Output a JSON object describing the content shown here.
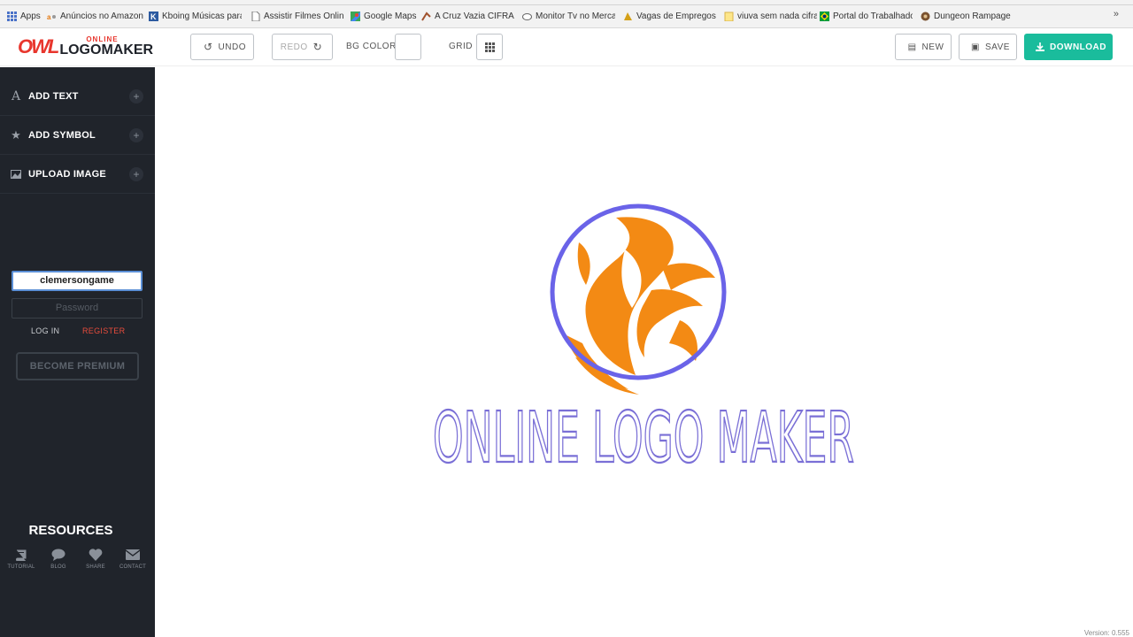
{
  "bookmarks": [
    {
      "label": "Apps",
      "icon": "apps-grid-icon"
    },
    {
      "label": "Anúncios no Amazon",
      "icon": "amazon-icon"
    },
    {
      "label": "Kboing Músicas para",
      "icon": "kboing-icon"
    },
    {
      "label": "Assistir Filmes Online",
      "icon": "page-icon"
    },
    {
      "label": "Google Maps",
      "icon": "maps-icon"
    },
    {
      "label": "A Cruz Vazia CIFRA S",
      "icon": "cifra-icon"
    },
    {
      "label": "Monitor Tv no Merca",
      "icon": "monitor-icon"
    },
    {
      "label": "Vagas de Empregos e",
      "icon": "vagas-icon"
    },
    {
      "label": "viuva sem nada cifra",
      "icon": "folder-icon"
    },
    {
      "label": "Portal do Trabalhador",
      "icon": "portal-icon"
    },
    {
      "label": "Dungeon Rampage n",
      "icon": "dungeon-icon"
    }
  ],
  "bookmarks_more": "»",
  "logo": {
    "mark": "OWL",
    "small": "ONLINE",
    "big": "LOGOMAKER"
  },
  "toolbar": {
    "undo": "UNDO",
    "redo": "REDO",
    "bg_color": "BG COLOR",
    "grid": "GRID",
    "new": "NEW",
    "save": "SAVE",
    "download": "DOWNLOAD"
  },
  "sidebar": {
    "items": [
      {
        "label": "ADD TEXT",
        "icon": "font-icon"
      },
      {
        "label": "ADD SYMBOL",
        "icon": "star-icon"
      },
      {
        "label": "UPLOAD IMAGE",
        "icon": "image-icon"
      }
    ],
    "username_value": "clemersongame",
    "password_placeholder": "Password",
    "login": "LOG IN",
    "register": "REGISTER",
    "premium": "BECOME PREMIUM",
    "resources_title": "RESOURCES",
    "resources": [
      {
        "label": "TUTORIAL",
        "icon": "book-icon"
      },
      {
        "label": "BLOG",
        "icon": "chat-icon"
      },
      {
        "label": "SHARE",
        "icon": "heart-icon"
      },
      {
        "label": "CONTACT",
        "icon": "envelope-icon"
      }
    ]
  },
  "canvas": {
    "brand_text": "ONLINE LOGO MAKER",
    "version": "Version: 0.555"
  },
  "colors": {
    "accent_download": "#1abc9c",
    "sidebar_bg": "#20242b",
    "register_red": "#e74c3c",
    "logo_circle": "#6a63e8",
    "logo_flame": "#f38a14",
    "brand_text": "#7a6fd6"
  }
}
